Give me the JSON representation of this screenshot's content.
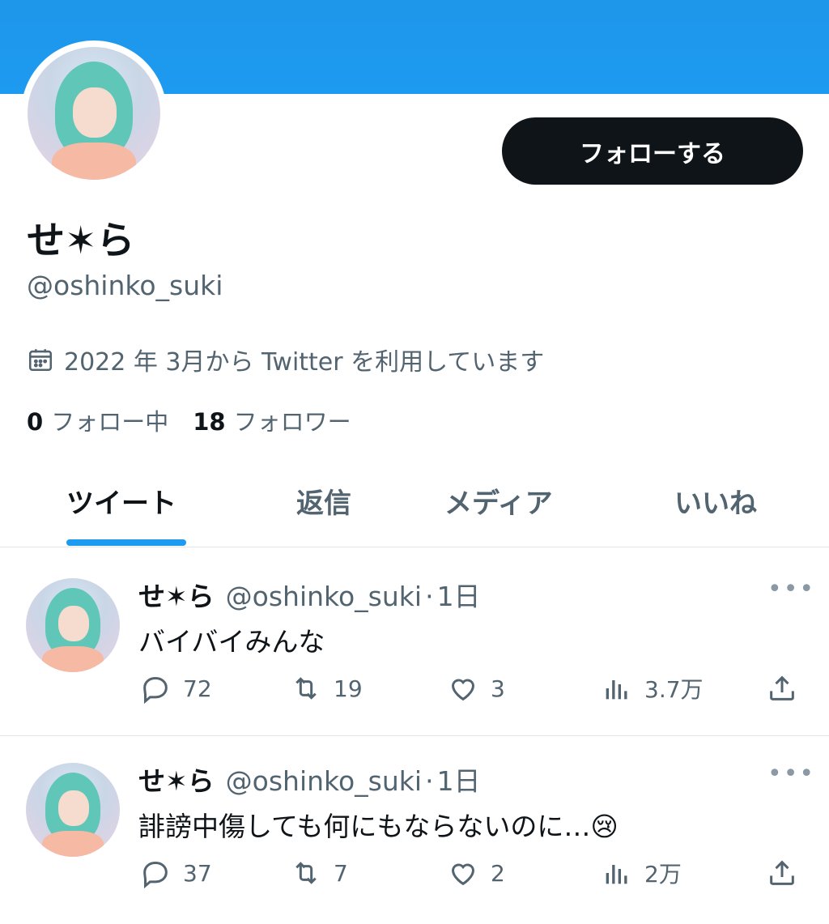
{
  "profile": {
    "follow_label": "フォローする",
    "name": "せ✶ら",
    "handle": "@oshinko_suki",
    "joined": "2022 年 3月から Twitter を利用しています",
    "following_count": "0",
    "following_label": "フォロー中",
    "followers_count": "18",
    "followers_label": "フォロワー"
  },
  "tabs": [
    {
      "label": "ツイート",
      "active": true
    },
    {
      "label": "返信",
      "active": false
    },
    {
      "label": "メディア",
      "active": false
    },
    {
      "label": "いいね",
      "active": false
    }
  ],
  "tweets": [
    {
      "name": "せ✶ら",
      "handle": "@oshinko_suki",
      "dot": "·",
      "time": "1日",
      "text": "バイバイみんな",
      "replies": "72",
      "retweets": "19",
      "likes": "3",
      "views": "3.7万"
    },
    {
      "name": "せ✶ら",
      "handle": "@oshinko_suki",
      "dot": "·",
      "time": "1日",
      "text": "誹謗中傷しても何にもならないのに…😢",
      "replies": "37",
      "retweets": "7",
      "likes": "2",
      "views": "2万"
    }
  ],
  "icons": {
    "calendar": "calendar-icon",
    "more": "more-icon",
    "reply": "reply-icon",
    "retweet": "retweet-icon",
    "like": "heart-icon",
    "views": "views-icon",
    "share": "share-icon"
  },
  "colors": {
    "brand": "#1d9bf0",
    "button": "#0f1419",
    "secondary_text": "#536471"
  }
}
